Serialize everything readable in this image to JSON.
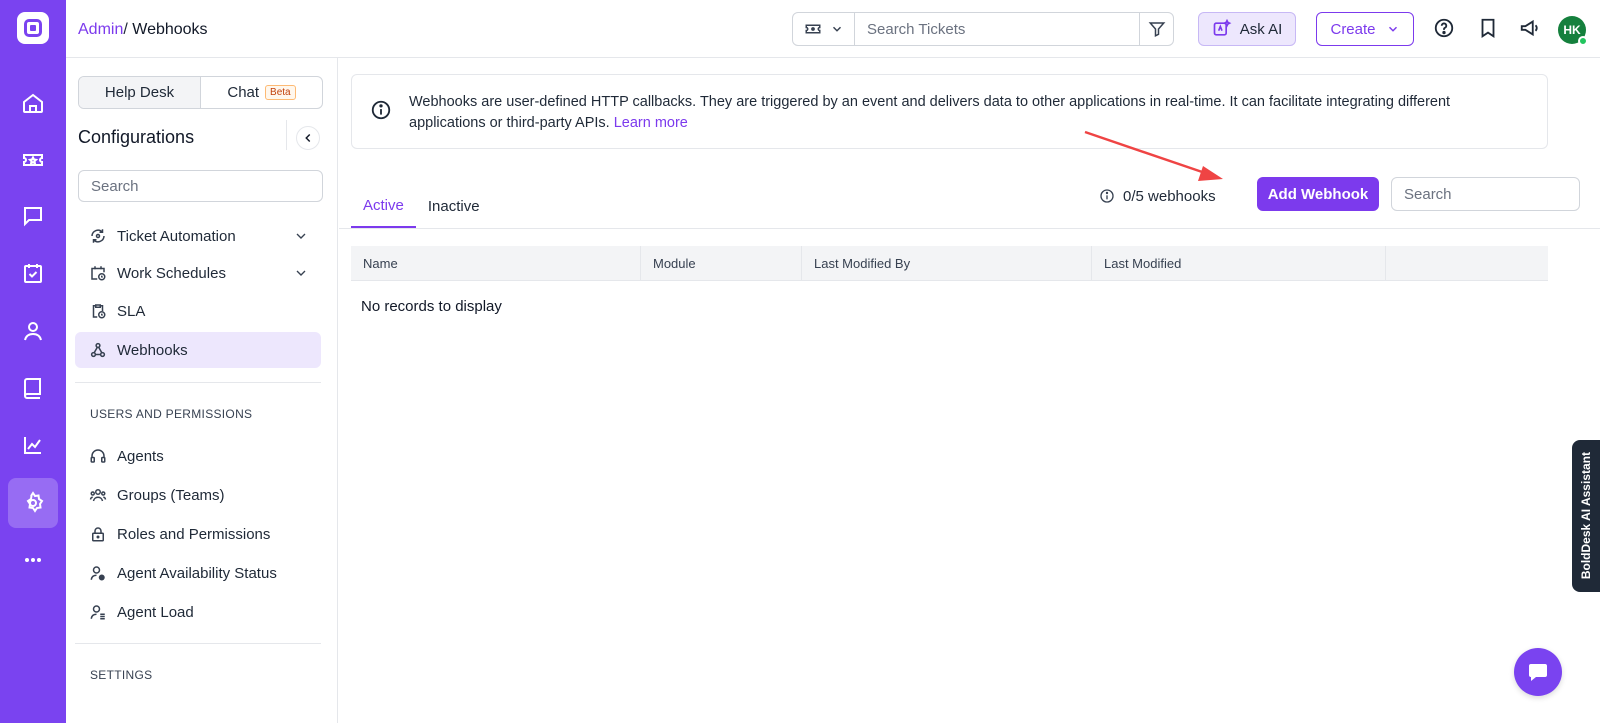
{
  "breadcrumb": {
    "root": "Admin",
    "separator": "/ ",
    "current": "Webhooks"
  },
  "header": {
    "search_placeholder": "Search Tickets",
    "ask_ai_label": "Ask AI",
    "create_label": "Create",
    "avatar_initials": "HK"
  },
  "config": {
    "seg_helpdesk": "Help Desk",
    "seg_chat": "Chat",
    "seg_beta": "Beta",
    "title": "Configurations",
    "search_placeholder": "Search",
    "items": [
      {
        "label": "Ticket Automation"
      },
      {
        "label": "Work Schedules"
      },
      {
        "label": "SLA"
      },
      {
        "label": "Webhooks"
      }
    ],
    "section_users": "USERS AND PERMISSIONS",
    "user_items": [
      {
        "label": "Agents"
      },
      {
        "label": "Groups (Teams)"
      },
      {
        "label": "Roles and Permissions"
      },
      {
        "label": "Agent Availability Status"
      },
      {
        "label": "Agent Load"
      }
    ],
    "section_settings": "SETTINGS"
  },
  "info": {
    "text": "Webhooks are user-defined HTTP callbacks. They are triggered by an event and delivers data to other applications in real-time. It can facilitate integrating different applications or third-party APIs.",
    "link": "Learn more"
  },
  "tabs": [
    {
      "label": "Active"
    },
    {
      "label": "Inactive"
    }
  ],
  "count_label": "0/5 webhooks",
  "add_button": "Add Webhook",
  "grid_search_placeholder": "Search",
  "columns": [
    "Name",
    "Module",
    "Last Modified By",
    "Last Modified",
    ""
  ],
  "empty_text": "No records to display",
  "assistant_label": "BoldDesk AI Assistant",
  "colors": {
    "brand": "#7a43f0",
    "accent": "#7c3aed",
    "annotation_arrow": "#ef4444"
  }
}
